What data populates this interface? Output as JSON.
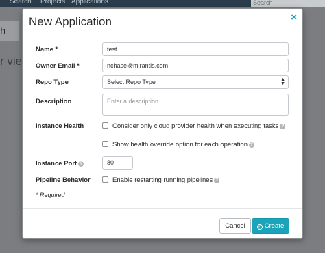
{
  "background": {
    "nav": [
      "Search",
      "Projects",
      "Applications"
    ],
    "search_placeholder": "Search",
    "fragment_1": "h",
    "fragment_2": "r view"
  },
  "modal": {
    "title": "New Application",
    "close_icon": "×",
    "fields": {
      "name": {
        "label": "Name *",
        "value": "test"
      },
      "owner_email": {
        "label": "Owner Email *",
        "value": "nchase@mirantis.com"
      },
      "repo_type": {
        "label": "Repo Type",
        "value": "Select Repo Type"
      },
      "description": {
        "label": "Description",
        "placeholder": "Enter a description"
      },
      "instance_health": {
        "label": "Instance Health",
        "option_1": "Consider only cloud provider health when executing tasks",
        "option_2": "Show health override option for each operation"
      },
      "instance_port": {
        "label": "Instance Port",
        "value": "80"
      },
      "pipeline_behavior": {
        "label": "Pipeline Behavior",
        "option": "Enable restarting running pipelines"
      }
    },
    "required_note": "* Required",
    "buttons": {
      "cancel": "Cancel",
      "create": "Create"
    }
  },
  "colors": {
    "accent": "#1aa3b9",
    "nav_bg": "#2b3d4c",
    "overlay": "#7b7d80"
  },
  "icons": {
    "help": "question-circle-icon",
    "check": "check-circle-icon",
    "close": "close-icon"
  }
}
